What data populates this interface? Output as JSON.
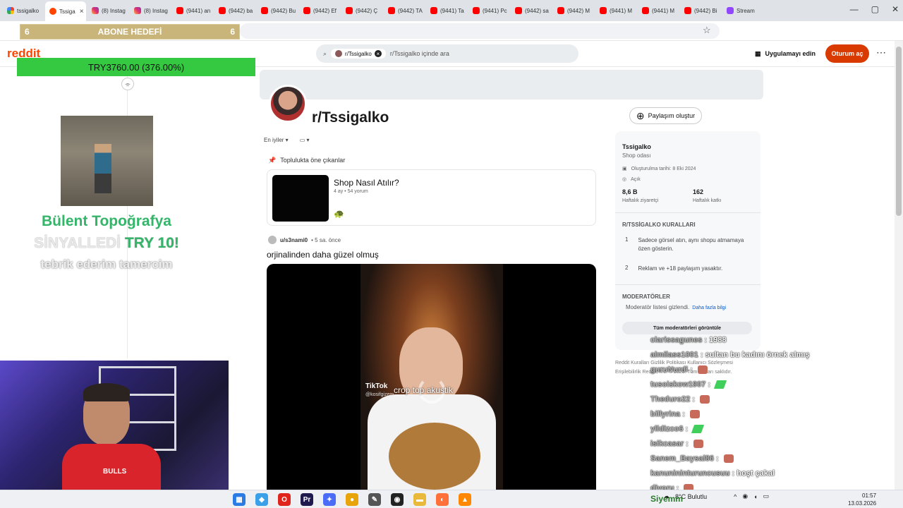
{
  "browser": {
    "tabs": [
      {
        "label": "tssigalko",
        "icon": "google",
        "active": false
      },
      {
        "label": "Tssiga",
        "icon": "reddit",
        "active": true
      },
      {
        "label": "(8) Instag",
        "icon": "instagram",
        "active": false
      },
      {
        "label": "(8) Instag",
        "icon": "instagram",
        "active": false
      },
      {
        "label": "(9441) an",
        "icon": "youtube",
        "active": false
      },
      {
        "label": "(9442) ba",
        "icon": "youtube",
        "active": false
      },
      {
        "label": "(9442) Bu",
        "icon": "youtube",
        "active": false
      },
      {
        "label": "(9442) Ef",
        "icon": "youtube",
        "active": false
      },
      {
        "label": "(9442) Ç",
        "icon": "youtube",
        "active": false
      },
      {
        "label": "(9442) TA",
        "icon": "youtube",
        "active": false
      },
      {
        "label": "(9441) Ta",
        "icon": "youtube",
        "active": false
      },
      {
        "label": "(9441) Pc",
        "icon": "youtube",
        "active": false
      },
      {
        "label": "(9442) sa",
        "icon": "youtube",
        "active": false
      },
      {
        "label": "(9442) M",
        "icon": "youtube",
        "active": false
      },
      {
        "label": "(9441) M",
        "icon": "youtube",
        "active": false
      },
      {
        "label": "(9441) M",
        "icon": "youtube",
        "active": false
      },
      {
        "label": "(9442) Bi",
        "icon": "youtube",
        "active": false
      },
      {
        "label": "Stream",
        "icon": "twitch",
        "active": false
      }
    ],
    "close_glyph": "×"
  },
  "overlay": {
    "goal": {
      "left": "6",
      "label": "ABONE HEDEFİ",
      "right": "6"
    },
    "progress": {
      "text": "TRY3760.00 (376.00%)",
      "percent": 376.0
    },
    "alert": {
      "line1": "Bülent Topoğrafya",
      "line2a": "SİNYALLEDİ",
      "line2b": "TRY 10!",
      "line3": "tebrik ederim tamercim"
    }
  },
  "reddit": {
    "logo": "reddit",
    "search": {
      "chip": "r/Tssigalko",
      "placeholder": "r/Tssigalko içinde ara"
    },
    "get_app": "Uygulamayı edin",
    "login": "Oturum aç",
    "more": "⋯",
    "subreddit": {
      "name": "r/Tssigalko"
    },
    "create_post": "Paylaşım oluştur",
    "sort": {
      "label": "En iyiler",
      "view_glyph": "▭"
    },
    "highlights_label": "Toplulukta öne çıkanlar",
    "pinned": {
      "title": "Shop Nasıl Atılır?",
      "meta": "4 ay • 54 yorum",
      "emoji": "🐢"
    },
    "post": {
      "user": "u/s3nami0",
      "time": "• 5 sa. önce",
      "title": "orjinalinden daha güzel olmuş",
      "tiktok": "TikTok",
      "tiktok_user": "@kosifgizem",
      "caption": "crop top akustik"
    },
    "sidebar": {
      "name": "Tssigalko",
      "description": "Shop odası",
      "created": "Oluşturulma tarihi: 8 Eki 2024",
      "visibility": "Açık",
      "stats": [
        {
          "value": "8,6 B",
          "label": "Haftalık ziyaretçi"
        },
        {
          "value": "162",
          "label": "Haftalık katkı"
        }
      ],
      "rules_header": "R/TSSİGALKO KURALLARI",
      "rules": [
        {
          "num": "1",
          "text": "Sadece görsel atın, aynı shopu atmamaya özen gösterin."
        },
        {
          "num": "2",
          "text": "Reklam ve +18 paylaşım yasaktır."
        }
      ],
      "mods_header": "MODERATÖRLER",
      "mods_hidden": "Moderatör listesi gizlendi.",
      "mods_more": "Daha fazla bilgi",
      "mods_button": "Tüm moderatörleri görüntüle"
    },
    "footer": {
      "line1": "Reddit Kuralları   Gizlilik Politikası   Kullanıcı Sözleşmesi",
      "line2": "Erişilebilirlik   Reddit, Inc. © 2026. Tüm hakları saklıdır."
    }
  },
  "chat": {
    "messages": [
      {
        "user": "clarissagunes",
        "text": "1988",
        "emote": false
      },
      {
        "user": "almilass1001",
        "text": "sultan bu kadını örnek almış",
        "emote": false
      },
      {
        "user": "guruNurdi",
        "text": "",
        "emote": true
      },
      {
        "user": "tusoiskow1907",
        "text": "",
        "emote": true
      },
      {
        "user": "Theduro22",
        "text": "",
        "emote": true
      },
      {
        "user": "billyrina",
        "text": "",
        "emote": true
      },
      {
        "user": "ylldizco6",
        "text": "",
        "emote": true
      },
      {
        "user": "isikcasar",
        "text": "",
        "emote": true
      },
      {
        "user": "Sanem_Baysal86",
        "text": "",
        "emote": true
      },
      {
        "user": "kanunininturuncusuu",
        "text": "hoşt çakal",
        "emote": false
      },
      {
        "user": "diyoru",
        "text": "",
        "emote": true
      }
    ],
    "viewer_name": "Siyemm"
  },
  "taskbar": {
    "weather": "8°C Bulutlu",
    "time": "01:57",
    "date": "13.03.2026"
  },
  "webcam": {
    "shirt_text": "BULLS"
  },
  "colors": {
    "reddit_orange": "#ff4500",
    "login_bg": "#d93a00",
    "progress_green": "#34c940",
    "alert_green": "#35b56a"
  }
}
